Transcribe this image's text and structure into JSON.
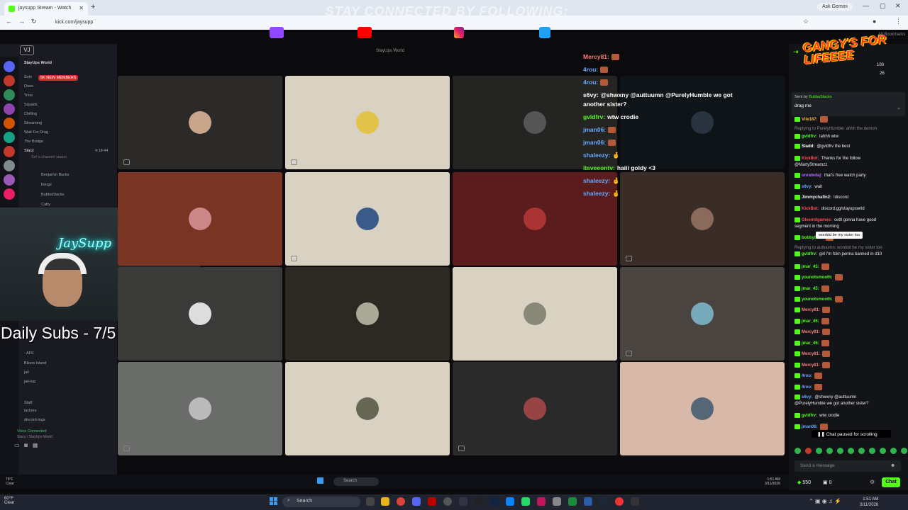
{
  "browser": {
    "tab_title": "jaysupp Stream - Watch",
    "new_tab": "+",
    "url": "kick.com/jaysupp",
    "ask_gemini": "Ask Gemini",
    "bookmarks": "All Bookmarks"
  },
  "stream": {
    "banner_title": "STAY CONNECTED BY FOLLOWING:",
    "window_title": "StayUps World",
    "vj_badge": "VJ",
    "daily_subs": "Daily Subs - 7/5",
    "neon_sign": "JaySupp"
  },
  "discord": {
    "server_name": "StayUps World",
    "new_members_badge": "5K NEW MEMBERS",
    "channels": [
      "Solo",
      "Duos",
      "Trios",
      "Squads",
      "Chilling",
      "Streaming",
      "Wait For Drag",
      "The Bridge",
      "Stacy"
    ],
    "stacy_status": "Set a channel status",
    "stacy_time": "4:18:44",
    "members": [
      "Benjamin Bucks",
      "bongz",
      "BubbaStacks",
      "Catty"
    ],
    "lower_items": [
      "- AFK",
      "Bikers Island",
      "jail",
      "jail-log",
      "Staff",
      "lackers",
      "discord-logs"
    ],
    "voice_connected": "Voice Connected",
    "voice_sub": "Stacy / StayUps World"
  },
  "overlay_chat": [
    {
      "user": "Mercy81:",
      "text": "",
      "color": "#ff7a7a"
    },
    {
      "user": "4rou:",
      "text": "",
      "color": "#6aa8ff"
    },
    {
      "user": "4rou:",
      "text": "",
      "color": "#6aa8ff"
    },
    {
      "user": "s6vy:",
      "text": "@shwxny @auttuumn @PurelyHumble we got",
      "color": "#fff"
    },
    {
      "user": "",
      "text": "another sister?",
      "color": "#fff"
    },
    {
      "user": "gvldfrv:",
      "text": "wtw crodie",
      "color": "#53fc18"
    },
    {
      "user": "jman06:",
      "text": "",
      "color": "#6aa8ff"
    },
    {
      "user": "jman06:",
      "text": "",
      "color": "#6aa8ff"
    },
    {
      "user": "shaleezy:",
      "text": "🤞",
      "color": "#6aa8ff"
    },
    {
      "user": "itsveeontv:",
      "text": "haiii goldy <3",
      "color": "#53fc18"
    },
    {
      "user": "shaleezy:",
      "text": "🤞",
      "color": "#6aa8ff"
    },
    {
      "user": "shaleezy:",
      "text": "🤞",
      "color": "#6aa8ff"
    }
  ],
  "kick_chat": {
    "overlay_logo": "GANGY'S FOR LIFEEEE",
    "viewer_count": "100",
    "viewer_count_2": "26",
    "pinned_sender_prefix": "Sent by",
    "pinned_sender": "BubbaStacks",
    "pinned_text": "drag me",
    "tooltip": "worddd be my sister too",
    "messages": [
      {
        "user": "Vile187:",
        "text": "",
        "color": "#ffb347"
      },
      {
        "user": "",
        "text": "Replying to PurelyHumble: ahhh the demon",
        "color": "#888"
      },
      {
        "user": "gvldfrv:",
        "text": "tahhh wtw",
        "color": "#53fc18"
      },
      {
        "user": "Sladd:",
        "text": "@gvldfrv the best",
        "color": "#fff"
      },
      {
        "user": "KickBot:",
        "text": "Thanks for the follow",
        "color": "#ff4d4d"
      },
      {
        "user": "",
        "text": "@MartyStreamzz",
        "color": "#eee"
      },
      {
        "user": "unratedaj:",
        "text": "that's free watch party",
        "color": "#b66cff"
      },
      {
        "user": "s6vy:",
        "text": "wait",
        "color": "#6aa8ff"
      },
      {
        "user": "Jimmychafin2:",
        "text": "!discord",
        "color": "#eee"
      },
      {
        "user": "KickBot:",
        "text": "discord.gg/stayupswrld",
        "color": "#ff4d4d"
      },
      {
        "user": "Gleemitgames:",
        "text": "cettl gonna have good",
        "color": "#ff4d4d"
      },
      {
        "user": "",
        "text": "segment in the morning",
        "color": "#eee"
      },
      {
        "user": "bobbyboo:",
        "text": "",
        "color": "#53fc18"
      },
      {
        "user": "",
        "text": "Replying to auttuumn: worddd be my sister too",
        "color": "#888"
      },
      {
        "user": "gvldfrv:",
        "text": "girl i'm fckn perma banned in d10",
        "color": "#53fc18"
      },
      {
        "user": "jmar_45:",
        "text": "",
        "color": "#53fc18"
      },
      {
        "user": "younotsmooth:",
        "text": "",
        "color": "#53fc18"
      },
      {
        "user": "jmar_45:",
        "text": "",
        "color": "#53fc18"
      },
      {
        "user": "younotsmooth:",
        "text": "",
        "color": "#53fc18"
      },
      {
        "user": "Mercy81:",
        "text": "",
        "color": "#ff7a7a"
      },
      {
        "user": "jmar_45:",
        "text": "",
        "color": "#53fc18"
      },
      {
        "user": "Mercy81:",
        "text": "",
        "color": "#ff7a7a"
      },
      {
        "user": "jmar_45:",
        "text": "",
        "color": "#53fc18"
      },
      {
        "user": "Mercy81:",
        "text": "",
        "color": "#ff7a7a"
      },
      {
        "user": "Mercy81:",
        "text": "",
        "color": "#ff7a7a"
      },
      {
        "user": "4rou:",
        "text": "",
        "color": "#6aa8ff"
      },
      {
        "user": "4rou:",
        "text": "",
        "color": "#6aa8ff"
      },
      {
        "user": "s6vy:",
        "text": "@shwxny @auttuumn",
        "color": "#6aa8ff"
      },
      {
        "user": "",
        "text": "@PurelyHumble we got another sister?",
        "color": "#eee"
      },
      {
        "user": "gvldfrv:",
        "text": "wtw crodie",
        "color": "#53fc18"
      },
      {
        "user": "jman06:",
        "text": "",
        "color": "#6aa8ff"
      }
    ],
    "paused": "Chat paused for scrolling",
    "send_placeholder": "Send a message",
    "points": "550",
    "zero": "0",
    "chat_button": "Chat"
  },
  "taskbar": {
    "weather_temp": "60°F",
    "weather_desc": "Clear",
    "search": "Search",
    "time": "1:51 AM",
    "date": "3/11/2026",
    "inner_weather": "78°F",
    "inner_weather_desc": "Clear",
    "inner_search": "Search",
    "inner_time": "1:51 AM",
    "inner_date": "3/11/2026"
  },
  "colors": {
    "kick_green": "#53fc18",
    "accent_red": "#ff3b1f"
  }
}
